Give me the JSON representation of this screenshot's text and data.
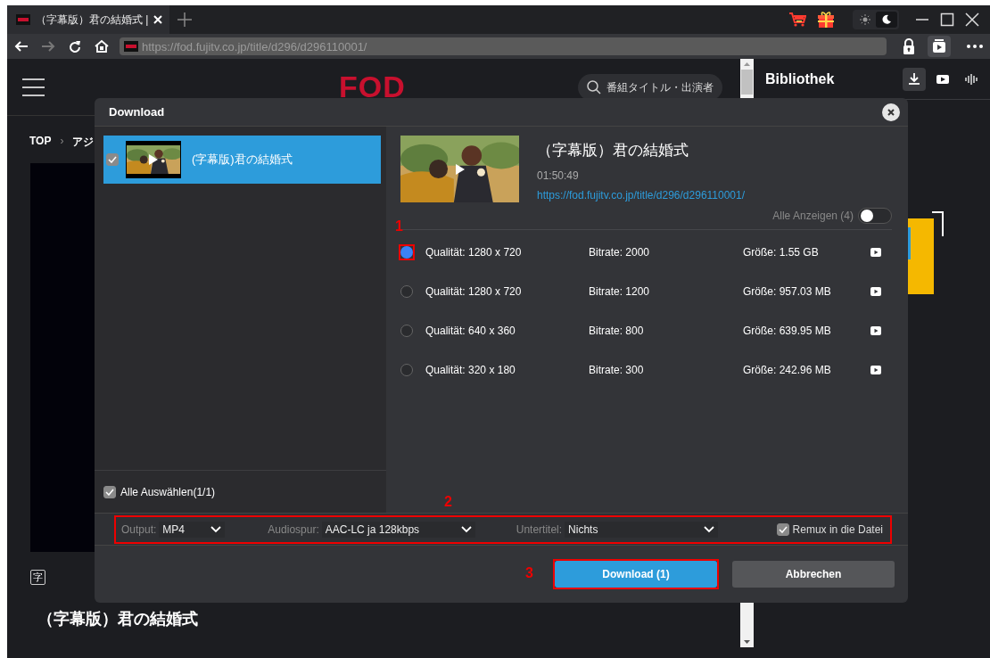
{
  "browser": {
    "tabs": [
      {
        "title": "（字幕版）君の結婚式 |",
        "selected": true
      }
    ],
    "theme_options": [
      {
        "kind": "light",
        "selected": false
      },
      {
        "kind": "dark",
        "selected": true
      }
    ],
    "nav_buttons": [
      {
        "kind": "back",
        "disabled": false
      },
      {
        "kind": "forward",
        "disabled": true
      },
      {
        "kind": "reload",
        "disabled": false
      },
      {
        "kind": "home",
        "disabled": false
      }
    ],
    "address": "https://fod.fujitv.co.jp/title/d296/d296110001/"
  },
  "page": {
    "logo": "FOD",
    "search": {
      "placeholder": "番組タイトル・出演者"
    },
    "breadcrumb": [
      "TOP",
      "›",
      "アジ"
    ],
    "subtitle_badge": "字",
    "title": "（字幕版）君の結婚式"
  },
  "library": {
    "title": "Bibliothek",
    "tabs": [
      {
        "kind": "download",
        "selected": true
      },
      {
        "kind": "video",
        "selected": false
      },
      {
        "kind": "audio",
        "selected": false
      }
    ]
  },
  "dialog": {
    "title": "Download",
    "items": [
      {
        "title": "(字幕版)君の結婚式",
        "checked": true,
        "selected": true
      }
    ],
    "select_all": {
      "label": "Alle Auswählen(1/1)",
      "checked": true
    },
    "detail": {
      "title": "（字幕版）君の結婚式",
      "duration": "01:50:49",
      "url": "https://fod.fujitv.co.jp/title/d296/d296110001/"
    },
    "show_all": {
      "label": "Alle Anzeigen",
      "count": "(4)",
      "on": false
    },
    "qualities": [
      {
        "quality": "Qualität: 1280 x 720",
        "bitrate": "Bitrate: 2000",
        "size": "Größe: 1.55 GB",
        "selected": true,
        "annotation": "1"
      },
      {
        "quality": "Qualität: 1280 x 720",
        "bitrate": "Bitrate: 1200",
        "size": "Größe: 957.03 MB",
        "selected": false
      },
      {
        "quality": "Qualität: 640 x 360",
        "bitrate": "Bitrate: 800",
        "size": "Größe: 639.95 MB",
        "selected": false
      },
      {
        "quality": "Qualität: 320 x 180",
        "bitrate": "Bitrate: 300",
        "size": "Größe: 242.96 MB",
        "selected": false
      }
    ],
    "options": {
      "annotation": "2",
      "fields": [
        {
          "kind": "output",
          "label": "Output:",
          "value": "MP4"
        },
        {
          "kind": "audio",
          "label": "Audiospur:",
          "value": "AAC-LC ja 128kbps"
        },
        {
          "kind": "subtitle",
          "label": "Untertitel:",
          "value": "Nichts"
        }
      ],
      "remux": {
        "label": "Remux in die Datei",
        "checked": true
      }
    },
    "buttons": [
      {
        "kind": "primary",
        "label": "Download (1)",
        "annotation": "3"
      },
      {
        "kind": "secondary",
        "label": "Abbrechen"
      }
    ]
  }
}
